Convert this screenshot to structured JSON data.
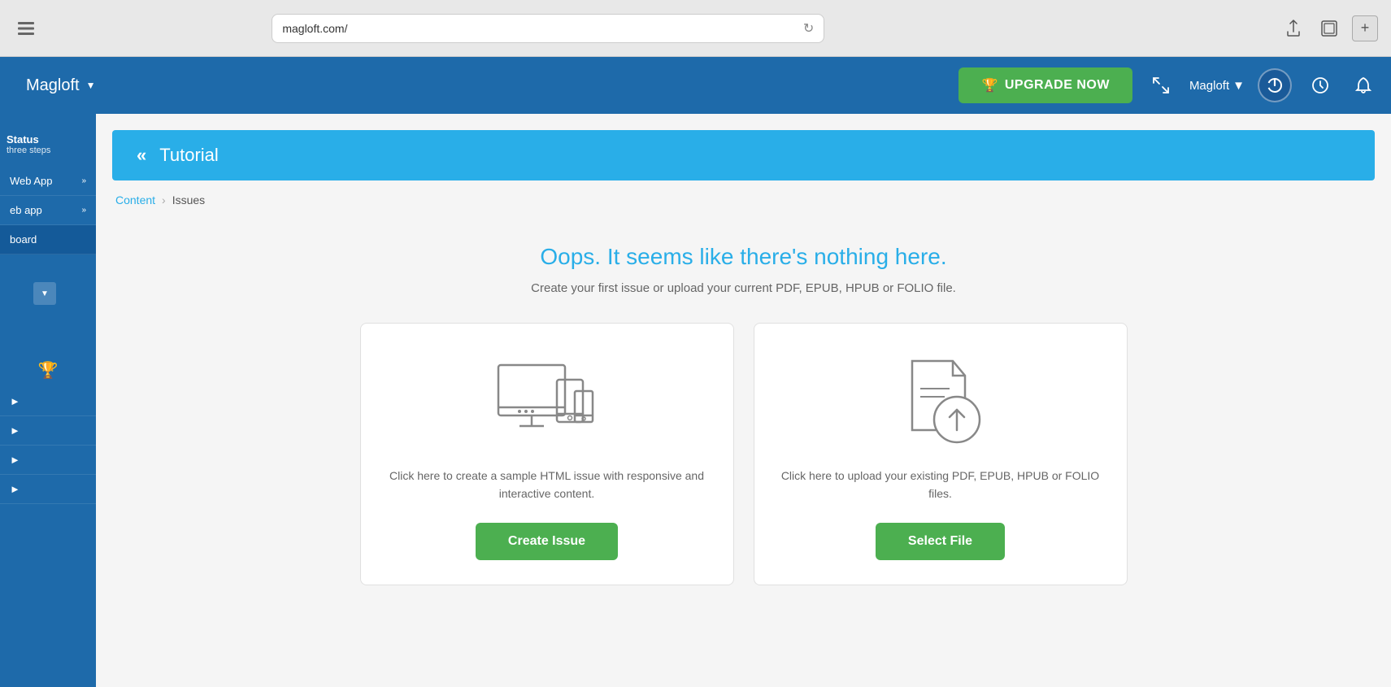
{
  "browser": {
    "url": "magloft.com/",
    "reload_label": "↻",
    "sidebar_icon": "⊞",
    "share_icon": "↑",
    "fullscreen_icon": "⧉",
    "new_tab_icon": "+"
  },
  "topnav": {
    "brand": "Magloft",
    "brand_dropdown": "▼",
    "upgrade_label": "UPGRADE NOW",
    "upgrade_icon": "🏆",
    "expand_icon": "⤢",
    "user_label": "Magloft",
    "user_dropdown": "▼",
    "power_icon": "⏻",
    "history_icon": "⟳",
    "bell_icon": "🔔"
  },
  "sidebar": {
    "status_label": "Status",
    "status_sub": "three steps",
    "items": [
      {
        "label": "Web App",
        "arrow": "»"
      },
      {
        "label": "eb app",
        "arrow": "»"
      },
      {
        "label": "board",
        "arrow": ""
      }
    ],
    "expand_arrow": "▼",
    "trophy_icon": "🏆",
    "arrow_icons": [
      "►",
      "►",
      "►"
    ]
  },
  "tutorial": {
    "icon": "«",
    "title": "Tutorial"
  },
  "breadcrumb": {
    "content": "Content",
    "sep": "›",
    "current": "Issues"
  },
  "empty_state": {
    "title": "Oops. It seems like there's nothing here.",
    "subtitle": "Create your first issue or upload your current PDF, EPUB, HPUB or FOLIO file."
  },
  "card_create": {
    "description": "Click here to create a sample HTML issue with responsive and interactive content.",
    "button_label": "Create Issue"
  },
  "card_upload": {
    "description": "Click here to upload your existing PDF, EPUB, HPUB or FOLIO files.",
    "button_label": "Select File"
  },
  "colors": {
    "nav_bg": "#1e6aaa",
    "upgrade_green": "#4caf50",
    "tutorial_blue": "#29aee8",
    "link_blue": "#29aee8"
  }
}
